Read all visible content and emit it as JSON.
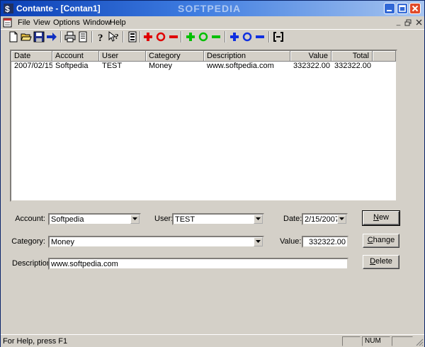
{
  "window": {
    "title": "Contante - [Contan1]",
    "watermark": "SOFTPEDIA"
  },
  "menu": [
    "File",
    "View",
    "Options",
    "Window",
    "Help"
  ],
  "toolbar": {
    "icons": [
      "new-file-icon",
      "open-folder-icon",
      "save-icon",
      "arrow-right-icon",
      "print-icon",
      "print-preview-icon",
      "help-icon",
      "context-help-icon",
      "list-icon",
      "add-red-icon",
      "circle-red-icon",
      "remove-red-icon",
      "add-green-icon",
      "circle-green-icon",
      "remove-green-icon",
      "add-blue-icon",
      "circle-blue-icon",
      "remove-blue-icon",
      "bracket-icon"
    ]
  },
  "table": {
    "columns": [
      "Date",
      "Account",
      "User",
      "Category",
      "Description",
      "Value",
      "Total"
    ],
    "rows": [
      [
        "2007/02/15",
        "Softpedia",
        "TEST",
        "Money",
        "www.softpedia.com",
        "332322.00",
        "332322.00"
      ]
    ]
  },
  "form": {
    "account_label": "Account:",
    "account_value": "Softpedia",
    "user_label": "User:",
    "user_value": "TEST",
    "date_label": "Date:",
    "date_value": "2/15/2007",
    "category_label": "Category:",
    "category_value": "Money",
    "value_label": "Value:",
    "value_value": "332322.00",
    "description_label": "Description:",
    "description_value": "www.softpedia.com"
  },
  "buttons": {
    "new_prefix": "",
    "new_accel": "N",
    "new_rest": "ew",
    "change_prefix": "",
    "change_accel": "C",
    "change_rest": "hange",
    "delete_prefix": "",
    "delete_accel": "D",
    "delete_rest": "elete"
  },
  "status": {
    "help_text": "For Help, press F1",
    "num": "NUM"
  }
}
